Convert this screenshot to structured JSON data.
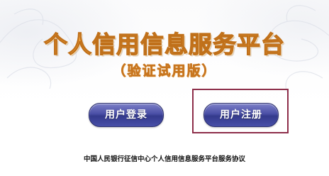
{
  "header": {
    "title": "个人信用信息服务平台",
    "subtitle": "（验证试用版）"
  },
  "actions": {
    "login_label": "用户登录",
    "register_label": "用户注册"
  },
  "footer": {
    "agreement_link": "中国人民银行征信中心个人信用信息服务平台服务协议"
  },
  "colors": {
    "title_fill": "#f0a13a",
    "title_stroke": "#c0701a",
    "button_fill": "#3f449b",
    "highlight_border": "#8e2e4a"
  }
}
